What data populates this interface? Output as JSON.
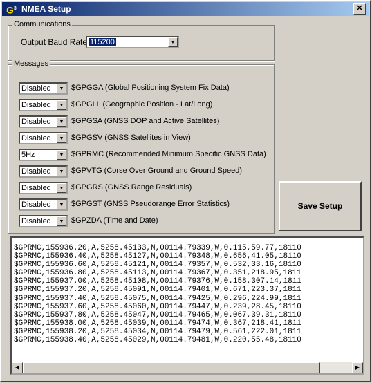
{
  "window": {
    "title": "NMEA Setup",
    "close_glyph": "✕",
    "icon": "g3-app-icon"
  },
  "communications": {
    "group_label": "Communications",
    "baud_label": "Output Baud Rate",
    "baud_value": "115200"
  },
  "messages": {
    "group_label": "Messages",
    "items": [
      {
        "rate": "Disabled",
        "label": "$GPGGA (Global Positioning System Fix Data)"
      },
      {
        "rate": "Disabled",
        "label": "$GPGLL (Geographic Position - Lat/Long)"
      },
      {
        "rate": "Disabled",
        "label": "$GPGSA (GNSS DOP and Active Satellites)"
      },
      {
        "rate": "Disabled",
        "label": "$GPGSV (GNSS Satellites in View)"
      },
      {
        "rate": "5Hz",
        "label": "$GPRMC (Recommended Minimum Specific GNSS Data)"
      },
      {
        "rate": "Disabled",
        "label": "$GPVTG (Corse Over Ground and Ground Speed)"
      },
      {
        "rate": "Disabled",
        "label": "$GPGRS (GNSS Range Residuals)"
      },
      {
        "rate": "Disabled",
        "label": "$GPGST (GNSS Pseudorange Error Statistics)"
      },
      {
        "rate": "Disabled",
        "label": "$GPZDA (Time and Date)"
      }
    ]
  },
  "save_button": {
    "label": "Save Setup"
  },
  "log": {
    "lines": [
      "$GPRMC,155936.20,A,5258.45133,N,00114.79339,W,0.115,59.77,18110",
      "$GPRMC,155936.40,A,5258.45127,N,00114.79348,W,0.656,41.05,18110",
      "$GPRMC,155936.60,A,5258.45121,N,00114.79357,W,0.532,33.16,18110",
      "$GPRMC,155936.80,A,5258.45113,N,00114.79367,W,0.351,218.95,1811",
      "$GPRMC,155937.00,A,5258.45108,N,00114.79376,W,0.158,307.14,1811",
      "$GPRMC,155937.20,A,5258.45091,N,00114.79401,W,0.671,223.37,1811",
      "$GPRMC,155937.40,A,5258.45075,N,00114.79425,W,0.296,224.99,1811",
      "$GPRMC,155937.60,A,5258.45060,N,00114.79447,W,0.239,28.45,18110",
      "$GPRMC,155937.80,A,5258.45047,N,00114.79465,W,0.067,39.31,18110",
      "$GPRMC,155938.00,A,5258.45039,N,00114.79474,W,0.367,218.41,1811",
      "$GPRMC,155938.20,A,5258.45034,N,00114.79479,W,0.561,222.01,1811",
      "$GPRMC,155938.40,A,5258.45029,N,00114.79481,W,0.220,55.48,18110"
    ]
  }
}
